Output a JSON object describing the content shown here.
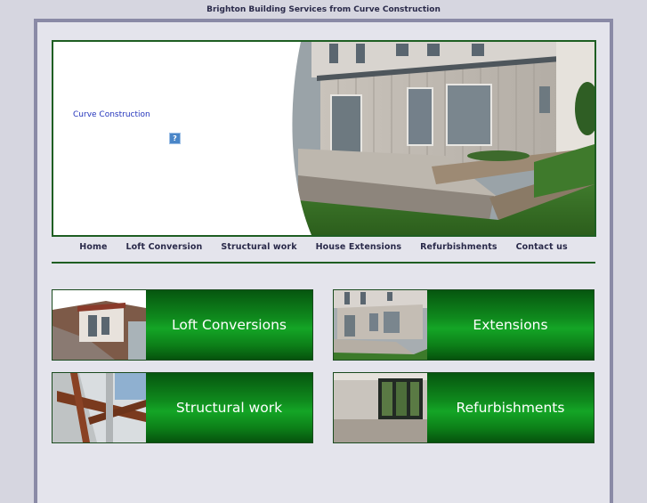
{
  "page": {
    "top_title": "Brighton Building Services from Curve Construction"
  },
  "hero": {
    "link_text": "Curve Construction",
    "broken_image_glyph": "?"
  },
  "nav": {
    "items": [
      {
        "label": "Home"
      },
      {
        "label": "Loft Conversion"
      },
      {
        "label": "Structural work"
      },
      {
        "label": "House Extensions"
      },
      {
        "label": "Refurbishments"
      },
      {
        "label": "Contact us"
      }
    ]
  },
  "tiles": [
    {
      "label": "Loft Conversions"
    },
    {
      "label": "Extensions"
    },
    {
      "label": "Structural work"
    },
    {
      "label": "Refurbishments"
    }
  ],
  "colors": {
    "background": "#d6d6e0",
    "frame_border": "#8a8aa6",
    "accent_green": "#1e5e22",
    "tile_green": "#14a526",
    "link_blue": "#2233bb"
  }
}
